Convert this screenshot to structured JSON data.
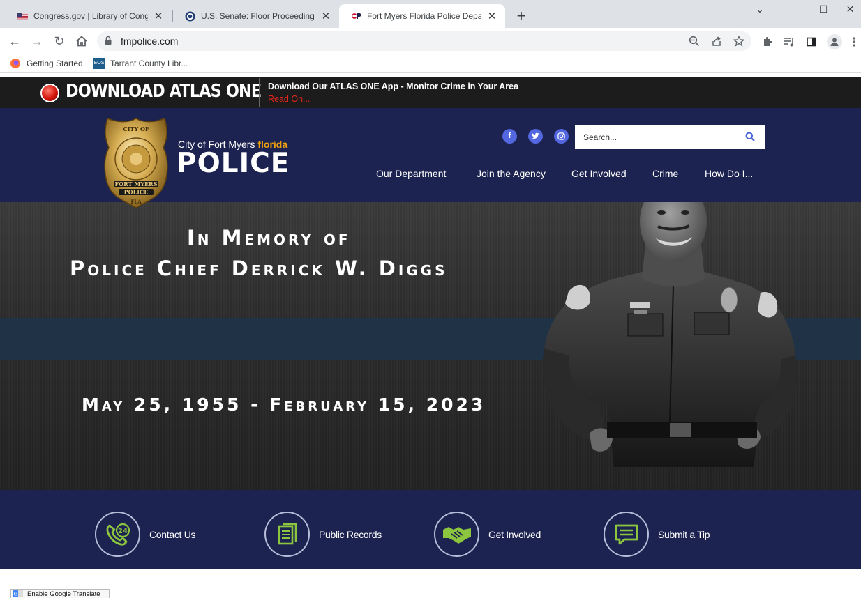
{
  "browser": {
    "tabs": [
      {
        "title": "Congress.gov | Library of Congress",
        "active": false
      },
      {
        "title": "U.S. Senate: Floor Proceedings",
        "active": false
      },
      {
        "title": "Fort Myers Florida Police Department",
        "active": true
      }
    ],
    "url": "fmpolice.com",
    "bookmarks": [
      {
        "label": "Getting Started"
      },
      {
        "label": "Tarrant County Libr..."
      }
    ]
  },
  "atlas": {
    "title": "DOWNLOAD ATLAS ONE",
    "headline": "Download Our ATLAS ONE App - Monitor Crime in Your Area",
    "read_on": "Read On..."
  },
  "logo": {
    "city": "City of Fort Myers",
    "state": "florida",
    "police": "POLICE",
    "badge_top": "CITY OF",
    "badge_mid": "FORT MYERS",
    "badge_bottom": "POLICE",
    "badge_fla": "FLA"
  },
  "search": {
    "placeholder": "Search..."
  },
  "nav": [
    "Our Department",
    "Join the Agency",
    "Get Involved",
    "Crime",
    "How Do I..."
  ],
  "social": [
    "facebook-icon",
    "twitter-icon",
    "instagram-icon"
  ],
  "hero": {
    "line1": "In Memory of",
    "line2": "Police Chief Derrick W. Diggs",
    "dates": "May 25, 1955 - February 15, 2023"
  },
  "quick_links": [
    {
      "label": "Contact Us",
      "icon": "phone-24-icon"
    },
    {
      "label": "Public Records",
      "icon": "document-icon"
    },
    {
      "label": "Get Involved",
      "icon": "handshake-icon"
    },
    {
      "label": "Submit a Tip",
      "icon": "chat-icon"
    }
  ],
  "translate": {
    "label": "Enable Google Translate"
  },
  "colors": {
    "navy": "#1d2350",
    "accent_green": "#8cc63f",
    "florida_orange": "#f2a20d",
    "read_on_red": "#e3261b",
    "social_blue": "#5267e0"
  }
}
